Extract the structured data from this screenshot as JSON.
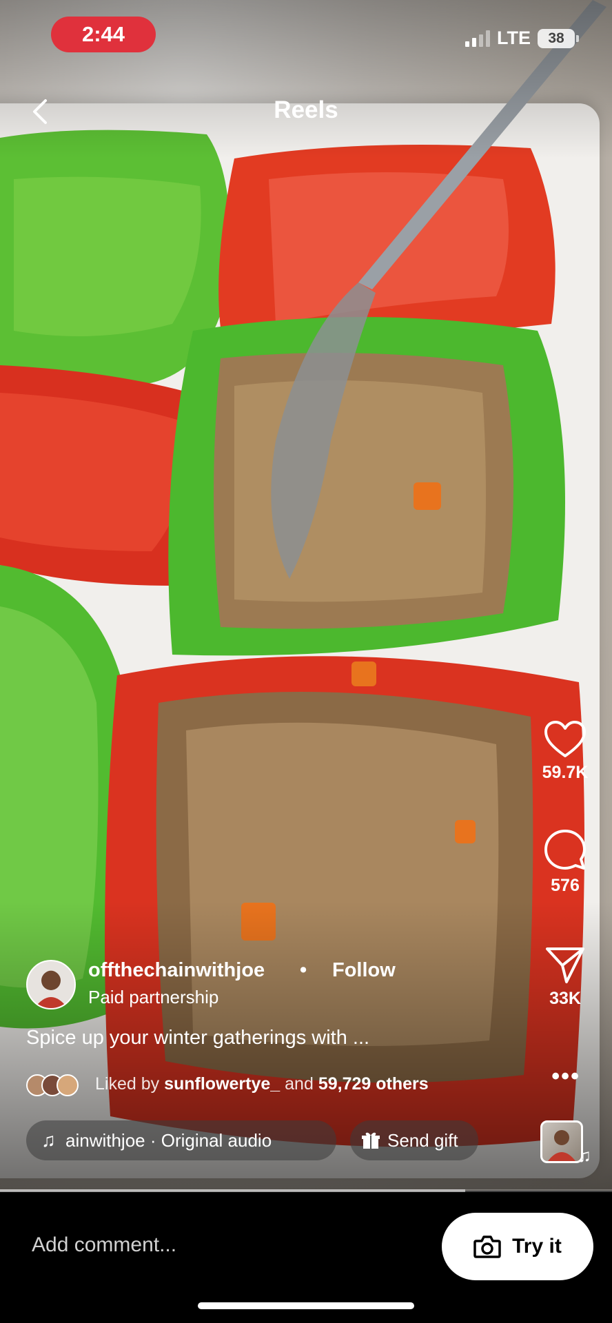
{
  "status_bar": {
    "time": "2:44",
    "network": "LTE",
    "battery": "38"
  },
  "header": {
    "title": "Reels",
    "back_icon": "chevron-left-icon"
  },
  "actions": {
    "likes": "59.7K",
    "comments": "576",
    "shares": "33K",
    "more_icon": "more-horizontal-icon"
  },
  "post": {
    "username": "offthechainwithjoe",
    "separator": "•",
    "follow_label": "Follow",
    "paid_partnership": "Paid partnership",
    "caption": "Spice up your winter gatherings with ...",
    "liked_prefix": "Liked by",
    "liked_user": "sunflowertye_",
    "liked_mid": "and",
    "liked_others": "59,729 others"
  },
  "audio": {
    "label": "ainwithjoe · Original audio",
    "icon": "music-note-icon"
  },
  "gift": {
    "label": "Send gift",
    "icon": "gift-icon"
  },
  "progress": 0.76,
  "bottom_bar": {
    "comment_placeholder": "Add comment...",
    "try_it_label": "Try it",
    "camera_icon": "camera-icon"
  },
  "colors": {
    "time_pill": "#e0313c",
    "red_pepper": "#d8301f",
    "green_pepper": "#4cb82e"
  }
}
